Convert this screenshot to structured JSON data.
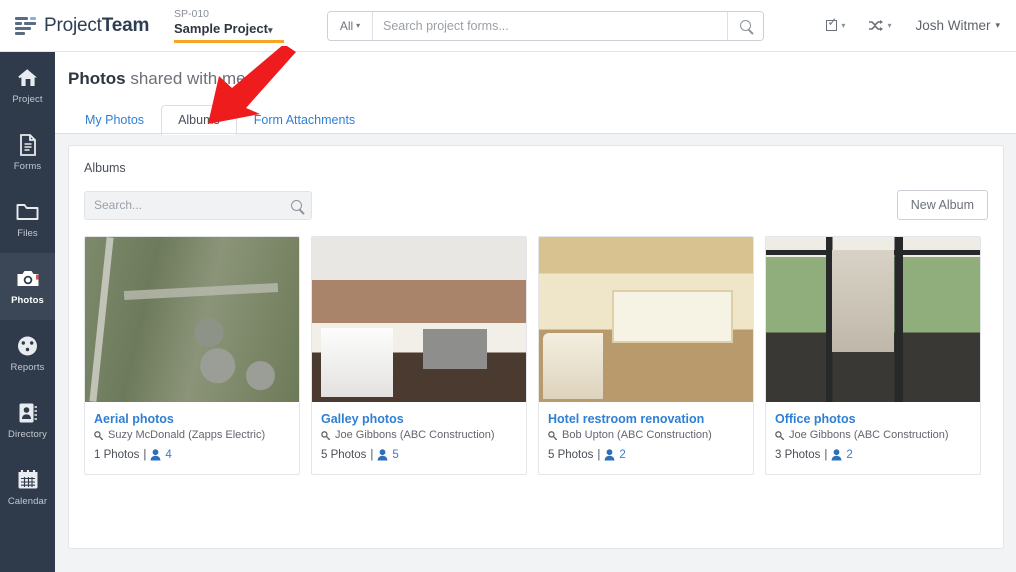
{
  "header": {
    "logo_text_regular": "Project",
    "logo_text_bold": "Team",
    "project_code": "SP-010",
    "project_name": "Sample Project",
    "project_caret": "▾",
    "search_scope": "All",
    "search_scope_caret": "▾",
    "search_placeholder": "Search project forms...",
    "search_value": "",
    "tasks_caret": "▾",
    "shuffle_glyph": "⤲",
    "shuffle_caret": "▾",
    "user_name": "Josh Witmer",
    "user_caret": "▾"
  },
  "sidebar": {
    "items": [
      {
        "label": "Project",
        "icon": "home-icon",
        "active": false
      },
      {
        "label": "Forms",
        "icon": "document-icon",
        "active": false
      },
      {
        "label": "Files",
        "icon": "folder-icon",
        "active": false
      },
      {
        "label": "Photos",
        "icon": "camera-icon",
        "active": true
      },
      {
        "label": "Reports",
        "icon": "gauge-icon",
        "active": false
      },
      {
        "label": "Directory",
        "icon": "contact-icon",
        "active": false
      },
      {
        "label": "Calendar",
        "icon": "calendar-icon",
        "active": false
      }
    ]
  },
  "page": {
    "title_bold": "Photos",
    "title_rest": " shared with me",
    "tabs": [
      {
        "label": "My Photos",
        "active": false
      },
      {
        "label": "Albums",
        "active": true
      },
      {
        "label": "Form Attachments",
        "active": false
      }
    ]
  },
  "panel": {
    "title": "Albums",
    "search_placeholder": "Search...",
    "search_value": "",
    "new_album_label": "New Album",
    "albums": [
      {
        "title": "Aerial photos",
        "owner": "Suzy McDonald (Zapps Electric)",
        "photos": "1 Photos",
        "separator": "|",
        "members": "4",
        "thumb": "aerial-photo-thumbnail"
      },
      {
        "title": "Galley photos",
        "owner": "Joe Gibbons (ABC Construction)",
        "photos": "5 Photos",
        "separator": "|",
        "members": "5",
        "thumb": "galley-photo-thumbnail"
      },
      {
        "title": "Hotel restroom renovation",
        "owner": "Bob Upton (ABC Construction)",
        "photos": "5 Photos",
        "separator": "|",
        "members": "2",
        "thumb": "hotel-restroom-photo-thumbnail"
      },
      {
        "title": "Office photos",
        "owner": "Joe Gibbons (ABC Construction)",
        "photos": "3 Photos",
        "separator": "|",
        "members": "2",
        "thumb": "office-photo-thumbnail"
      }
    ]
  },
  "colors": {
    "accent_blue": "#2f7fd4",
    "sidebar_bg": "#2f3a4b",
    "sidebar_active": "#3b4757",
    "project_underline": "#f5a623",
    "annotation_arrow": "#ee1c1c",
    "page_bg": "#f2f3f5"
  },
  "annotation": {
    "shape": "red-arrow",
    "points_to": "Albums"
  }
}
